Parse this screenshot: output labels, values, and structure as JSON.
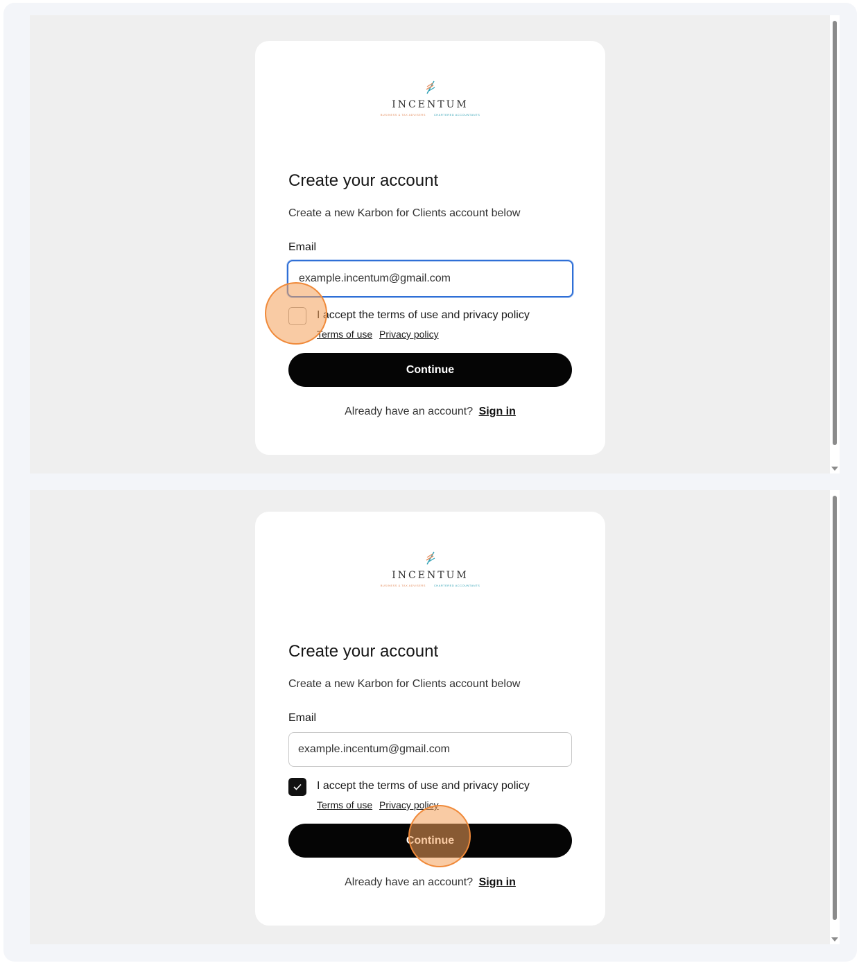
{
  "steps": [
    {
      "logo": {
        "name": "INCENTUM",
        "tag_left": "BUSINESS & TAX ADVISERS",
        "tag_right": "CHARTERED ACCOUNTANTS"
      },
      "title": "Create your account",
      "subtitle": "Create a new Karbon for Clients account below",
      "email_label": "Email",
      "email_value": "example.incentum@gmail.com",
      "email_focused": true,
      "accept_label": "I accept the terms of use and privacy policy",
      "accept_checked": false,
      "terms_link": "Terms of use",
      "privacy_link": "Privacy policy",
      "continue_label": "Continue",
      "signin_prompt": "Already have an account?",
      "signin_link": "Sign in",
      "click_target": "terms-checkbox"
    },
    {
      "logo": {
        "name": "INCENTUM",
        "tag_left": "BUSINESS & TAX ADVISERS",
        "tag_right": "CHARTERED ACCOUNTANTS"
      },
      "title": "Create your account",
      "subtitle": "Create a new Karbon for Clients account below",
      "email_label": "Email",
      "email_value": "example.incentum@gmail.com",
      "email_focused": false,
      "accept_label": "I accept the terms of use and privacy policy",
      "accept_checked": true,
      "terms_link": "Terms of use",
      "privacy_link": "Privacy policy",
      "continue_label": "Continue",
      "signin_prompt": "Already have an account?",
      "signin_link": "Sign in",
      "click_target": "continue-button"
    }
  ],
  "colors": {
    "accent_focus": "#2f6fd6",
    "button_bg": "#050505",
    "click_marker": "#f08a3a",
    "logo_orange": "#e38a5a",
    "logo_teal": "#2fa0b4"
  }
}
